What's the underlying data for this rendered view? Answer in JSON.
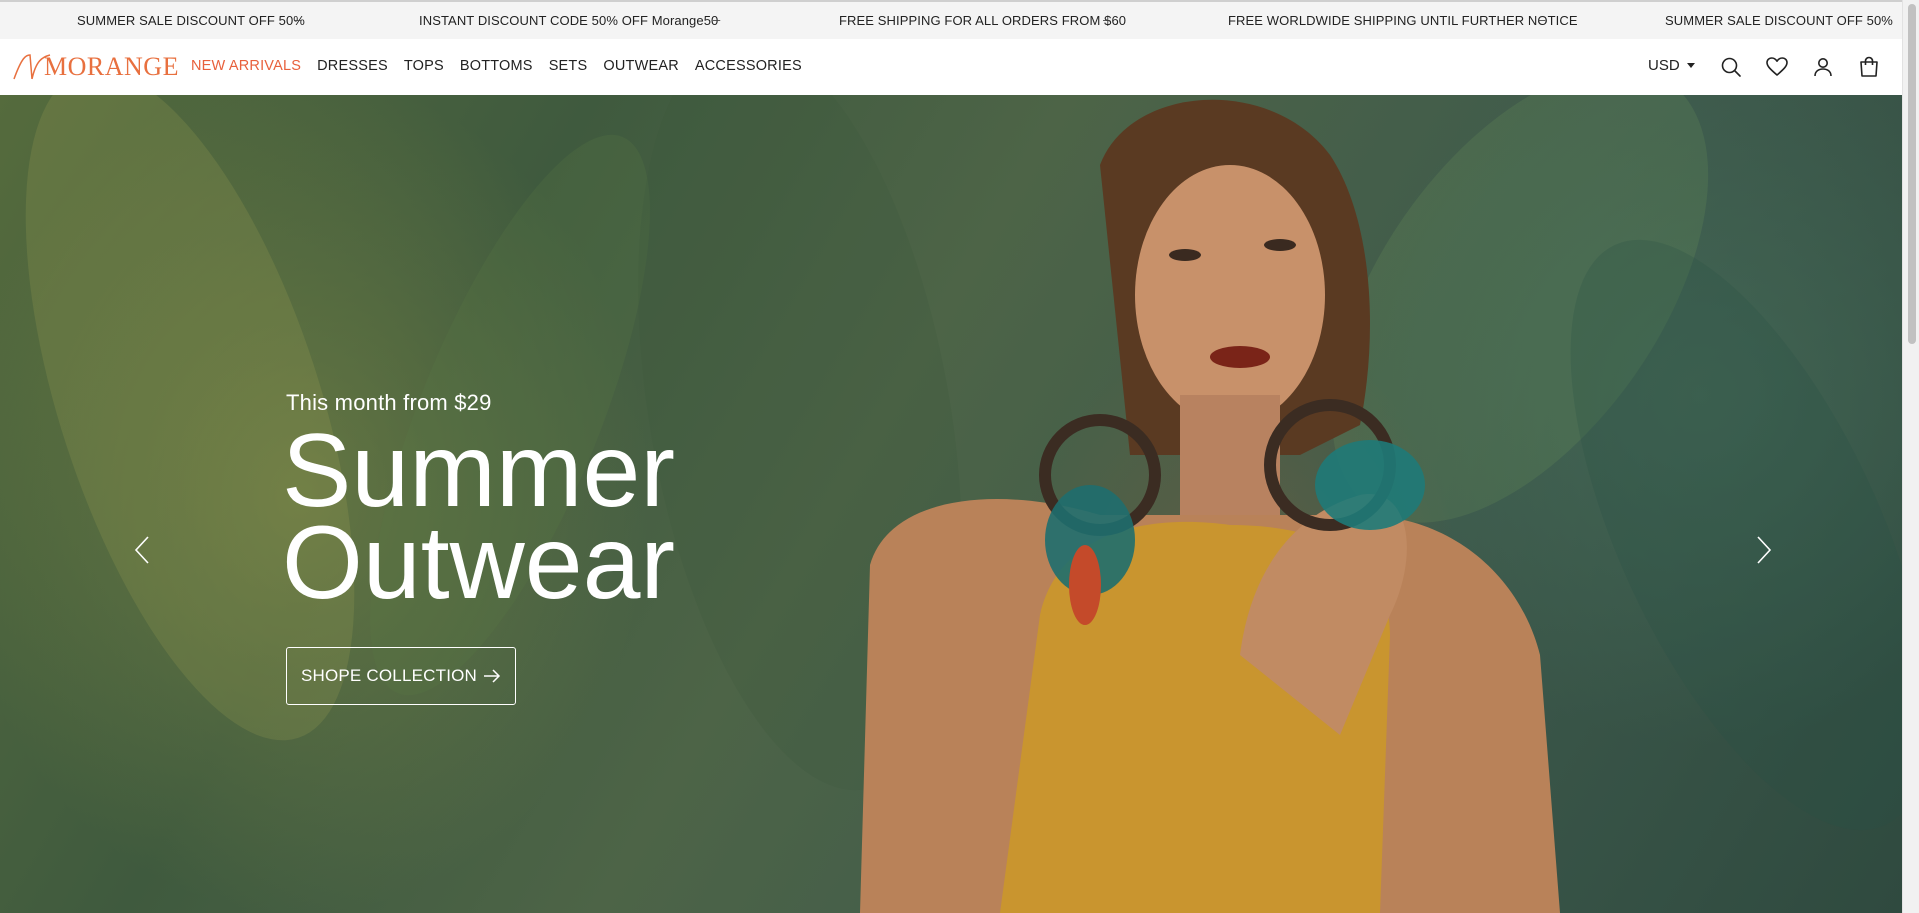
{
  "announcements": [
    "SUMMER SALE DISCOUNT OFF 50%",
    "INSTANT DISCOUNT CODE 50% OFF Morange50",
    "FREE SHIPPING FOR ALL ORDERS FROM $60",
    "FREE WORLDWIDE SHIPPING UNTIL FURTHER NOTICE",
    "SUMMER SALE DISCOUNT OFF 50%"
  ],
  "separator": "–",
  "brand": {
    "name": "MORANGE",
    "color": "#e8703f"
  },
  "nav": {
    "items": [
      {
        "label": "NEW ARRIVALS",
        "active": true
      },
      {
        "label": "DRESSES",
        "active": false
      },
      {
        "label": "TOPS",
        "active": false
      },
      {
        "label": "BOTTOMS",
        "active": false
      },
      {
        "label": "SETS",
        "active": false
      },
      {
        "label": "OUTWEAR",
        "active": false
      },
      {
        "label": "ACCESSORIES",
        "active": false
      }
    ],
    "accent_color": "#e8603c"
  },
  "header": {
    "currency": "USD",
    "icons": [
      "search-icon",
      "heart-icon",
      "user-icon",
      "cart-icon"
    ]
  },
  "hero": {
    "subtitle": "This month from $29",
    "title_line1": "Summer",
    "title_line2": "Outwear",
    "button_label": "SHOPE COLLECTION",
    "button_icon": "arrow-right-icon",
    "prev_icon": "chevron-left-icon",
    "next_icon": "chevron-right-icon"
  }
}
